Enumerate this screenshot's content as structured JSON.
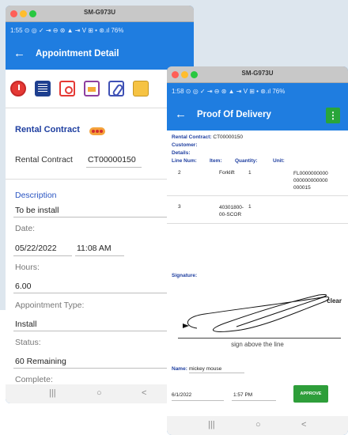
{
  "back_window": {
    "mac_title": "SM-G973U",
    "status_text": "1:55 ⊙ ◎ ✓ ⇥ ⊖ ⊛ ▲ ⇥ V ⊞ •   ⊛.ıl 76%",
    "appbar_title": "Appointment Detail",
    "rental_contract_heading": "Rental Contract",
    "rental_contract_label": "Rental Contract",
    "rental_contract_value": "CT00000150",
    "description_heading": "Description",
    "description_value": "To be install",
    "date_label": "Date:",
    "date_value": "05/22/2022",
    "time_value": "11:08 AM",
    "hours_label": "Hours:",
    "hours_value": "6.00",
    "appt_type_label": "Appointment Type:",
    "appt_type_value": "Install",
    "status_label": "Status:",
    "status_value": "60 Remaining",
    "complete_label": "Complete:",
    "nav": {
      "recent": "|||",
      "home": "○",
      "back": "<"
    }
  },
  "front_window": {
    "mac_title": "SM-G973U",
    "status_text": "1:58 ⊙ ◎ ✓ ⇥ ⊖ ⊛ ▲ ⇥ V ⊞ •   ⊛.ıl 76%",
    "appbar_title": "Proof Of Delivery",
    "menu_icon": "⋮",
    "rental_contract_label": "Rental Contract:",
    "rental_contract_value": "CT00000150",
    "customer_label": "Customer:",
    "details_label": "Details:",
    "columns": [
      "Line Num:",
      "Item:",
      "Quantity:",
      "Unit:"
    ],
    "rows": [
      {
        "line": "2",
        "item": "Forklift",
        "qty": "1",
        "unit": "FL0000000000 000000000000 000015"
      },
      {
        "line": "3",
        "item": "40301800-00-SCOR",
        "qty": "1",
        "unit": ""
      }
    ],
    "signature_label": "Signature:",
    "clear_label": "clear",
    "sign_above": "sign above the line",
    "name_label": "Name:",
    "name_value": "mickey mouse",
    "date_value": "6/1/2022",
    "time_value": "1:57 PM",
    "approve_label": "APPROVE",
    "nav": {
      "recent": "|||",
      "home": "○",
      "back": "<"
    }
  },
  "colors": {
    "accent": "#1f7de0",
    "approve": "#2e9e3a",
    "heading": "#1f3fa0"
  }
}
